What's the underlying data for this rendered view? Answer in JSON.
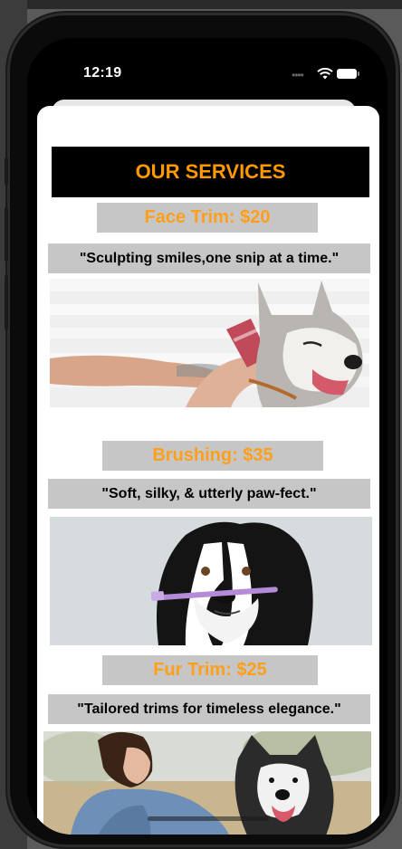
{
  "status_bar": {
    "time": "12:19"
  },
  "page": {
    "title": "OUR SERVICES",
    "services": [
      {
        "price_label": "Face Trim: $20",
        "tagline": "\"Sculpting smiles,one snip at a time.\""
      },
      {
        "price_label": "Brushing: $35",
        "tagline": "\"Soft, silky, & utterly paw-fect.\""
      },
      {
        "price_label": "Fur Trim: $25",
        "tagline": "\"Tailored trims for timeless elegance.\""
      }
    ]
  },
  "colors": {
    "accent": "#ff9900",
    "box_gray": "#c6c6c6",
    "header_bg": "#000000"
  }
}
